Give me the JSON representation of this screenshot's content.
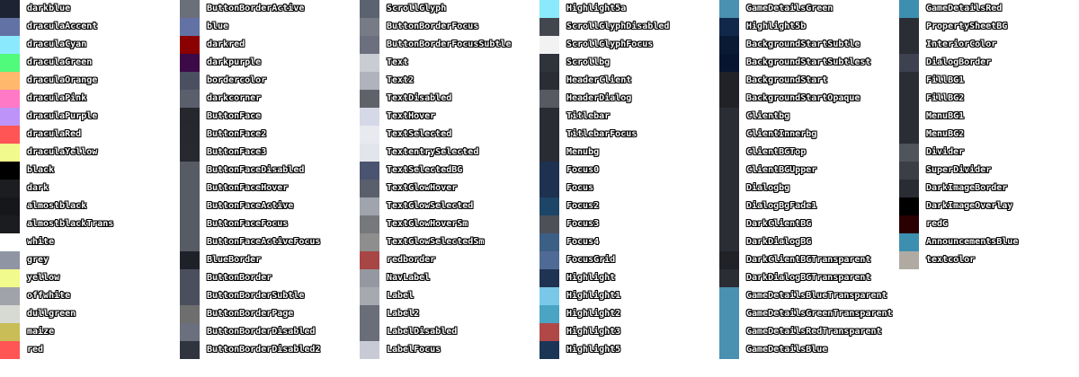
{
  "columns": [
    {
      "swatches": [
        {
          "label": "darkblue",
          "color": "#1d2333"
        },
        {
          "label": "draculaAccent",
          "color": "#6272a4"
        },
        {
          "label": "draculaCyan",
          "color": "#8be9fd"
        },
        {
          "label": "draculaGreen",
          "color": "#50fa7b"
        },
        {
          "label": "draculaOrange",
          "color": "#ffb86c"
        },
        {
          "label": "draculaPink",
          "color": "#ff79c6"
        },
        {
          "label": "draculaPurple",
          "color": "#bd93f9"
        },
        {
          "label": "draculaRed",
          "color": "#ff5555"
        },
        {
          "label": "draculaYellow",
          "color": "#f1fa8c"
        },
        {
          "label": "black",
          "color": "#000000"
        },
        {
          "label": "dark",
          "color": "#1b1d21"
        },
        {
          "label": "almostblack",
          "color": "#15171a"
        },
        {
          "label": "almostblackTrans",
          "color": "#1a1c1f"
        },
        {
          "label": "white",
          "color": "#ffffff"
        },
        {
          "label": "grey",
          "color": "#8f95a3"
        },
        {
          "label": "yellow",
          "color": "#f1fa8c"
        },
        {
          "label": "offwhite",
          "color": "#a0a3aa"
        },
        {
          "label": "dullgreen",
          "color": "#d6dad2"
        },
        {
          "label": "maize",
          "color": "#c8bd56"
        },
        {
          "label": "red",
          "color": "#ff5555"
        }
      ]
    },
    {
      "swatches": [
        {
          "label": "ButtonBorderActive",
          "color": "#6b6f7a"
        },
        {
          "label": "blue",
          "color": "#6272a4"
        },
        {
          "label": "darkred",
          "color": "#8b0000"
        },
        {
          "label": "darkpurple",
          "color": "#3c0a46"
        },
        {
          "label": "bordercolor",
          "color": "#4a5060"
        },
        {
          "label": "darkcorner",
          "color": "#5b5f6b"
        },
        {
          "label": "ButtonFace",
          "color": "#25272d"
        },
        {
          "label": "ButtonFace2",
          "color": "#26282e"
        },
        {
          "label": "ButtonFace3",
          "color": "#27292f"
        },
        {
          "label": "ButtonFaceDisabled",
          "color": "#575b64"
        },
        {
          "label": "ButtonFaceHover",
          "color": "#575b64"
        },
        {
          "label": "ButtonFaceActive",
          "color": "#575b64"
        },
        {
          "label": "ButtonFaceFocus",
          "color": "#575b64"
        },
        {
          "label": "ButtonFaceActiveFocus",
          "color": "#575b64"
        },
        {
          "label": "BlueBorder",
          "color": "#1e2128"
        },
        {
          "label": "ButtonBorder",
          "color": "#4b4f5d"
        },
        {
          "label": "ButtonBorderSubtle",
          "color": "#4b4f5d"
        },
        {
          "label": "ButtonBorderPage",
          "color": "#6e6e6e"
        },
        {
          "label": "ButtonBorderDisabled",
          "color": "#6b6f7e"
        },
        {
          "label": "ButtonBorderDisabled2",
          "color": "#30343f"
        }
      ]
    },
    {
      "swatches": [
        {
          "label": "ScrollGlyph",
          "color": "#5c6370"
        },
        {
          "label": "ButtonBorderFocus",
          "color": "#777b86"
        },
        {
          "label": "ButtonBorderFocusSubtle",
          "color": "#6b6f7e"
        },
        {
          "label": "Text",
          "color": "#c9ccd3"
        },
        {
          "label": "Text2",
          "color": "#b0b3bb"
        },
        {
          "label": "TextDisabled",
          "color": "#5f6269"
        },
        {
          "label": "TextHover",
          "color": "#d5d8e7"
        },
        {
          "label": "TextSelected",
          "color": "#e8eaf0"
        },
        {
          "label": "TextentrySelected",
          "color": "#e3e5ec"
        },
        {
          "label": "TextSelectedBG",
          "color": "#4a5470"
        },
        {
          "label": "TextGlowHover",
          "color": "#595f6b"
        },
        {
          "label": "TextGlowSelected",
          "color": "#a0a4ad"
        },
        {
          "label": "TextGlowHoverSm",
          "color": "#76787c"
        },
        {
          "label": "TextGlowSelectedSm",
          "color": "#8e8e8e"
        },
        {
          "label": "redborder",
          "color": "#a84545"
        },
        {
          "label": "NavLabel",
          "color": "#9598a0"
        },
        {
          "label": "Label",
          "color": "#a6a9b0"
        },
        {
          "label": "Label2",
          "color": "#6a6e78"
        },
        {
          "label": "LabelDisabled",
          "color": "#6a6e78"
        },
        {
          "label": "LabelFocus",
          "color": "#c8cad6"
        }
      ]
    },
    {
      "swatches": [
        {
          "label": "Highlight5a",
          "color": "#8be9fd"
        },
        {
          "label": "ScrollGlyphDisabled",
          "color": "#42464f"
        },
        {
          "label": "ScrollGlyphFocus",
          "color": "#f2f2f2"
        },
        {
          "label": "Scrollbg",
          "color": "#2f333b"
        },
        {
          "label": "HeaderClient",
          "color": "#2a2d35"
        },
        {
          "label": "HeaderDialog",
          "color": "#575a62"
        },
        {
          "label": "Titlebar",
          "color": "#2a2c34"
        },
        {
          "label": "TitlebarFocus",
          "color": "#2a2c34"
        },
        {
          "label": "Menubg",
          "color": "#2a2c34"
        },
        {
          "label": "Focus0",
          "color": "#1e3150"
        },
        {
          "label": "Focus",
          "color": "#1e3150"
        },
        {
          "label": "Focus2",
          "color": "#1d4567"
        },
        {
          "label": "Focus3",
          "color": "#4d5057"
        },
        {
          "label": "Focus4",
          "color": "#3c5f86"
        },
        {
          "label": "FocusGrid",
          "color": "#506a96"
        },
        {
          "label": "Highlight",
          "color": "#1f3452"
        },
        {
          "label": "Highlight1",
          "color": "#79c8e8"
        },
        {
          "label": "Highlight2",
          "color": "#4aa4c4"
        },
        {
          "label": "Highlight3",
          "color": "#b04848"
        },
        {
          "label": "Highlight5",
          "color": "#1b3556"
        }
      ]
    },
    {
      "swatches": [
        {
          "label": "GameDetailsGreen",
          "color": "#4a90b0"
        },
        {
          "label": "Highlight5b",
          "color": "#12284b"
        },
        {
          "label": "BackgroundStartSubtle",
          "color": "#0a1a35"
        },
        {
          "label": "BackgroundStartSubtlest",
          "color": "#081530"
        },
        {
          "label": "BackgroundStart",
          "color": "#202228"
        },
        {
          "label": "BackgroundStartOpaque",
          "color": "#202228"
        },
        {
          "label": "Clientbg",
          "color": "#2b2d35"
        },
        {
          "label": "ClientInnerbg",
          "color": "#2b2d35"
        },
        {
          "label": "ClientBGTop",
          "color": "#2b2d35"
        },
        {
          "label": "ClientBGUpper",
          "color": "#2b2d35"
        },
        {
          "label": "Dialogbg",
          "color": "#2b2d35"
        },
        {
          "label": "DialogBgFade1",
          "color": "#2b2d35"
        },
        {
          "label": "DarkClientBG",
          "color": "#2b2d35"
        },
        {
          "label": "DarkDialogBG",
          "color": "#2b2d35"
        },
        {
          "label": "DarkClientBGTransparent",
          "color": "#202228"
        },
        {
          "label": "DarkDialogBGTransparent",
          "color": "#2b2d35"
        },
        {
          "label": "GameDetailsBlueTransparent",
          "color": "#4a90b0"
        },
        {
          "label": "GameDetailsGreenTransparent",
          "color": "#4a90b0"
        },
        {
          "label": "GameDetailsRedTransparent",
          "color": "#4a90b0"
        },
        {
          "label": "GameDetailsBlue",
          "color": "#4a90b0"
        }
      ]
    },
    {
      "swatches": [
        {
          "label": "GameDetailsRed",
          "color": "#3d8fb0"
        },
        {
          "label": "PropertySheetBG",
          "color": "#2b2d35"
        },
        {
          "label": "InteriorColor",
          "color": "#2b2d35"
        },
        {
          "label": "DialogBorder",
          "color": "#3e4150"
        },
        {
          "label": "FillBG1",
          "color": "#2b2d35"
        },
        {
          "label": "FillBG2",
          "color": "#2b2d35"
        },
        {
          "label": "MenuBG1",
          "color": "#2b2d35"
        },
        {
          "label": "MenuBG2",
          "color": "#2b2d35"
        },
        {
          "label": "Divider",
          "color": "#50545b"
        },
        {
          "label": "SuperDivider",
          "color": "#3b3e45"
        },
        {
          "label": "DarkImageBorder",
          "color": "#2a2c34"
        },
        {
          "label": "DarkImageOverlay",
          "color": "#000000"
        },
        {
          "label": "redG",
          "color": "#2a0000"
        },
        {
          "label": "AnnouncementsBlue",
          "color": "#3d8fb0"
        },
        {
          "label": "textcolor",
          "color": "#b0aaa3"
        }
      ]
    }
  ]
}
